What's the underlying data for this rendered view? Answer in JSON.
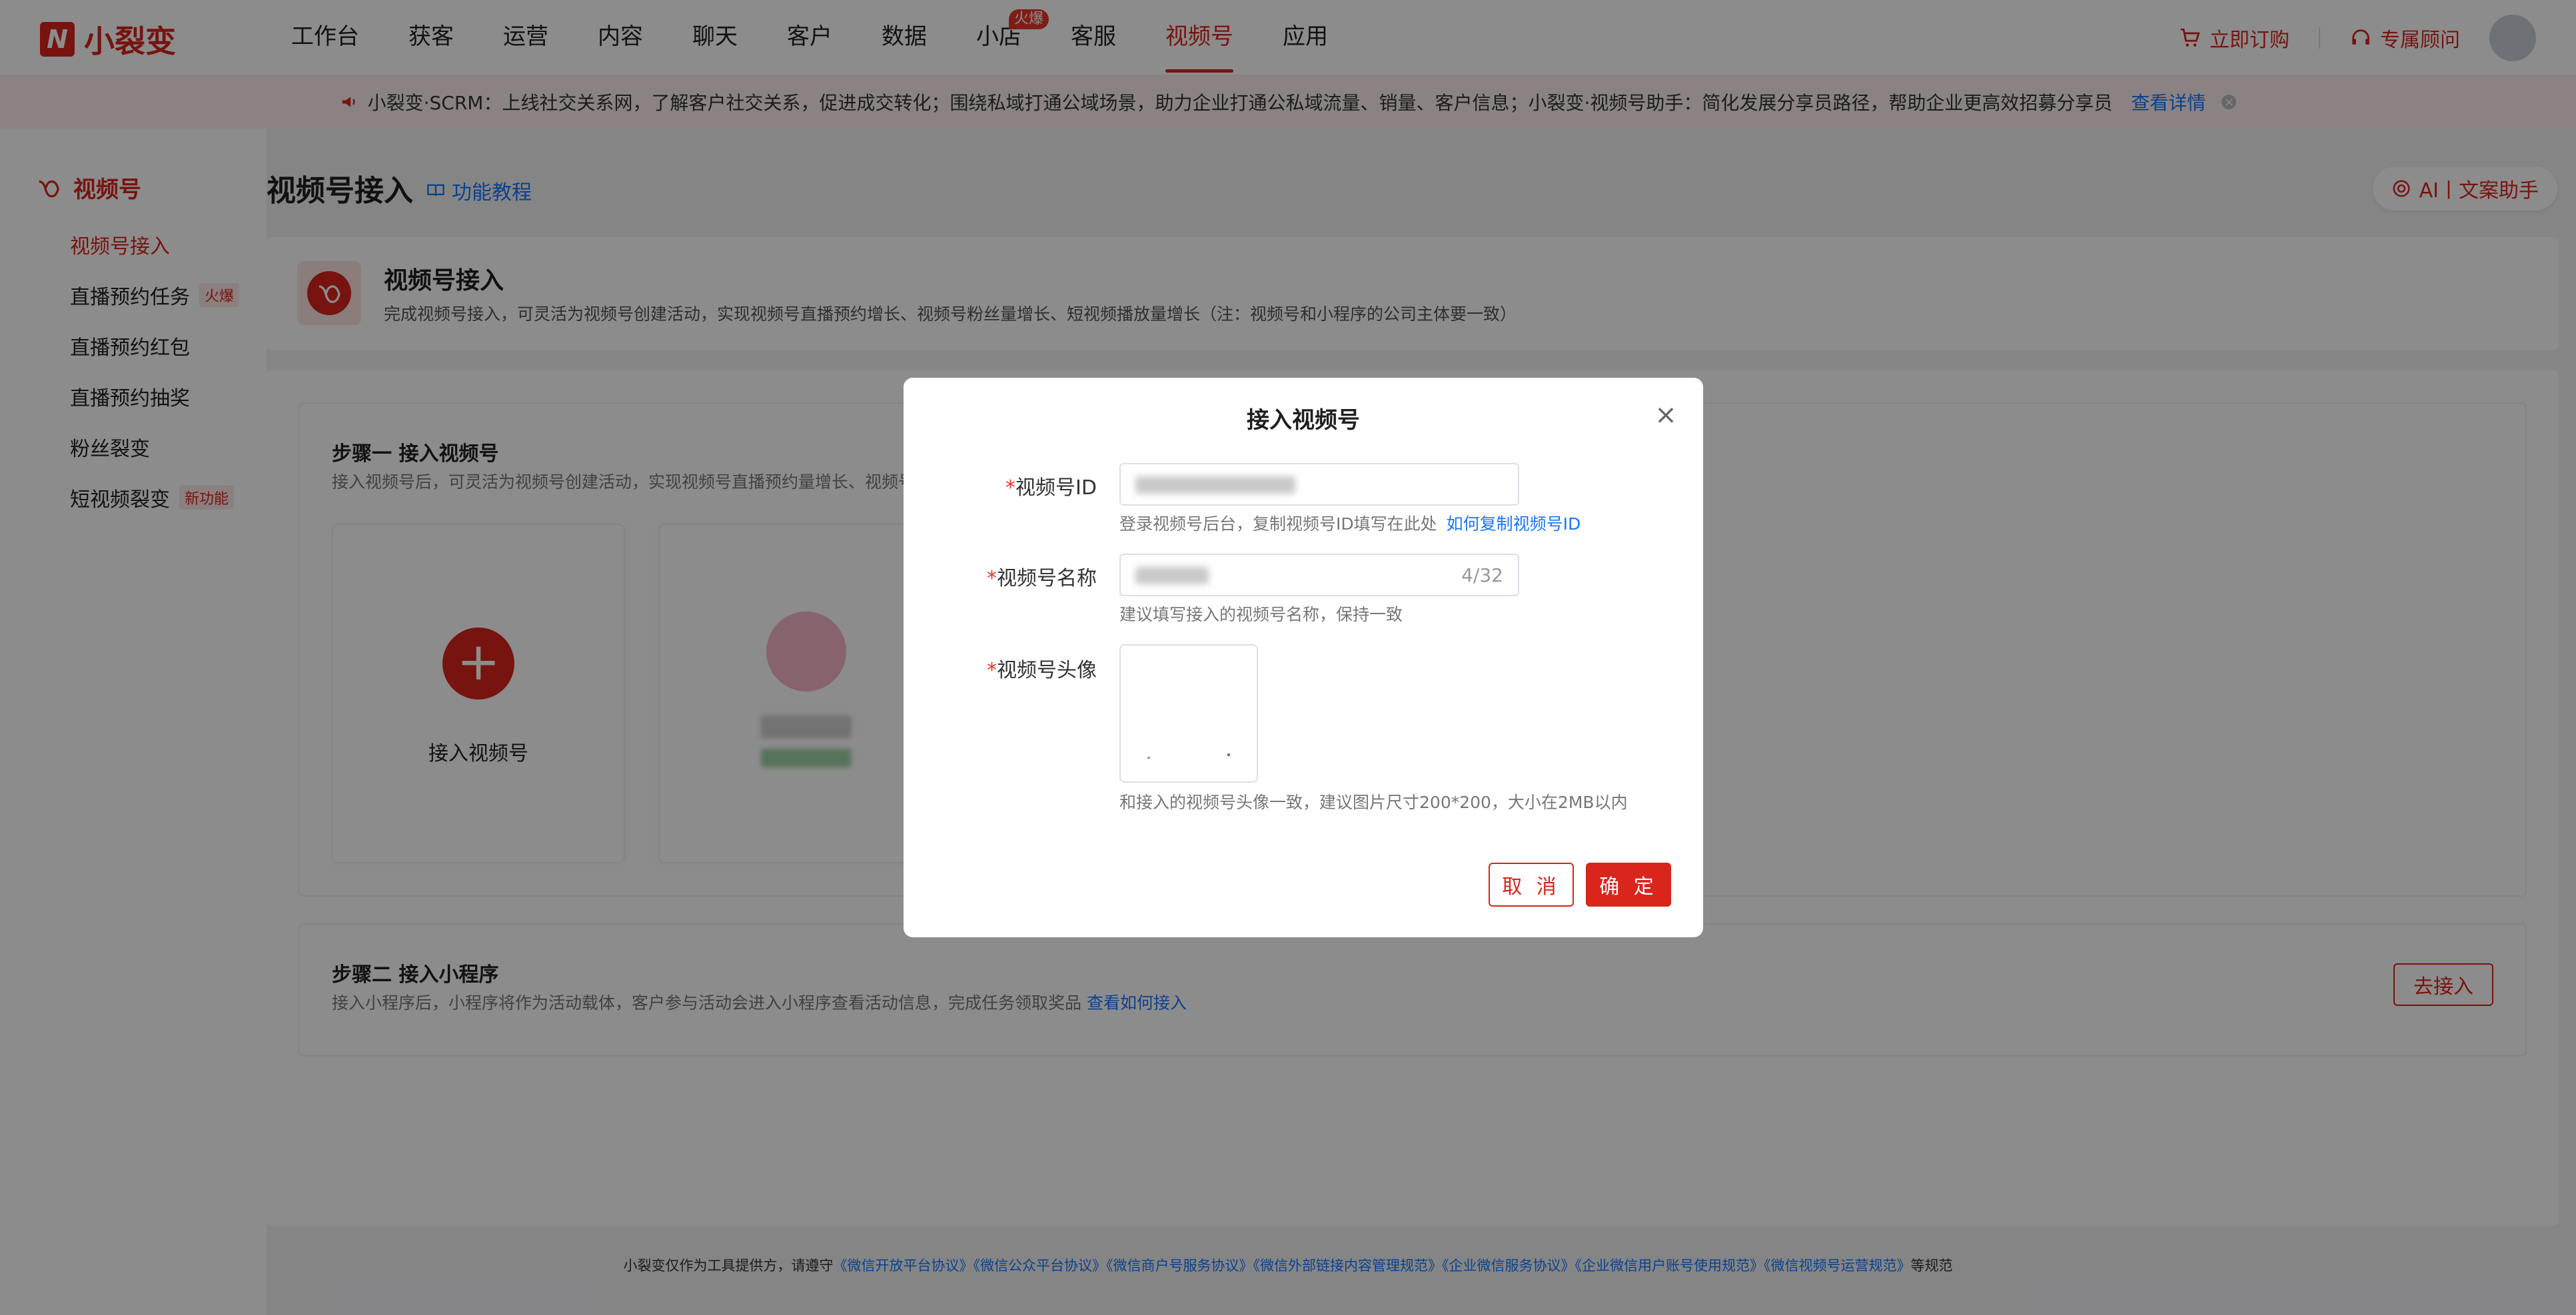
{
  "app": {
    "logo_mark": "N",
    "logo_text": "小裂变"
  },
  "nav": {
    "items": [
      {
        "label": "工作台"
      },
      {
        "label": "获客"
      },
      {
        "label": "运营"
      },
      {
        "label": "内容"
      },
      {
        "label": "聊天"
      },
      {
        "label": "客户"
      },
      {
        "label": "数据"
      },
      {
        "label": "小店",
        "badge": "火爆"
      },
      {
        "label": "客服"
      },
      {
        "label": "视频号"
      },
      {
        "label": "应用"
      }
    ],
    "order_label": "立即订购",
    "consultant_label": "专属顾问"
  },
  "notice": {
    "text": "小裂变·SCRM：上线社交关系网，了解客户社交关系，促进成交转化；围绕私域打通公域场景，助力企业打通公私域流量、销量、客户信息；小裂变·视频号助手：简化发展分享员路径，帮助企业更高效招募分享员",
    "more": "查看详情",
    "close": "×"
  },
  "sidebar": {
    "title": "视频号",
    "items": [
      {
        "label": "视频号接入"
      },
      {
        "label": "直播预约任务",
        "tag": "火爆"
      },
      {
        "label": "直播预约红包"
      },
      {
        "label": "直播预约抽奖"
      },
      {
        "label": "粉丝裂变"
      },
      {
        "label": "短视频裂变",
        "tag": "新功能"
      }
    ]
  },
  "page": {
    "title": "视频号接入",
    "tutorial": "功能教程",
    "ai_label": "AI丨文案助手"
  },
  "intro": {
    "title": "视频号接入",
    "desc": "完成视频号接入，可灵活为视频号创建活动，实现视频号直播预约增长、视频号粉丝量增长、短视频播放量增长（注：视频号和小程序的公司主体要一致）"
  },
  "step1": {
    "title": "步骤一    接入视频号",
    "desc": "接入视频号后，可灵活为视频号创建活动，实现视频号直播预约量增长、视频号粉",
    "add_label": "接入视频号",
    "add_symbol": "+"
  },
  "step2": {
    "title": "步骤二    接入小程序",
    "desc": "接入小程序后，小程序将作为活动载体，客户参与活动会进入小程序查看活动信息，完成任务领取奖品",
    "link": "查看如何接入",
    "button": "去接入"
  },
  "footer": {
    "prefix": "小裂变仅作为工具提供方，请遵守",
    "links": "《微信开放平台协议》《微信公众平台协议》《微信商户号服务协议》《微信外部链接内容管理规范》《企业微信服务协议》《企业微信用户账号使用规范》《微信视频号运营规范》",
    "suffix": "等规范"
  },
  "modal": {
    "title": "接入视频号",
    "close": "×",
    "id_label": "视频号ID",
    "id_hint": "登录视频号后台，复制视频号ID填写在此处",
    "id_hint_link": "如何复制视频号ID",
    "name_label": "视频号名称",
    "name_count": "4/32",
    "name_hint": "建议填写接入的视频号名称，保持一致",
    "avatar_label": "视频号头像",
    "avatar_hint": "和接入的视频号头像一致，建议图片尺寸200*200，大小在2MB以内",
    "required_mark": "*",
    "cancel": "取 消",
    "ok": "确 定"
  },
  "colors": {
    "brand": "#d9251c",
    "link": "#1677ff",
    "overlay": "rgba(0,0,0,0.45)"
  }
}
